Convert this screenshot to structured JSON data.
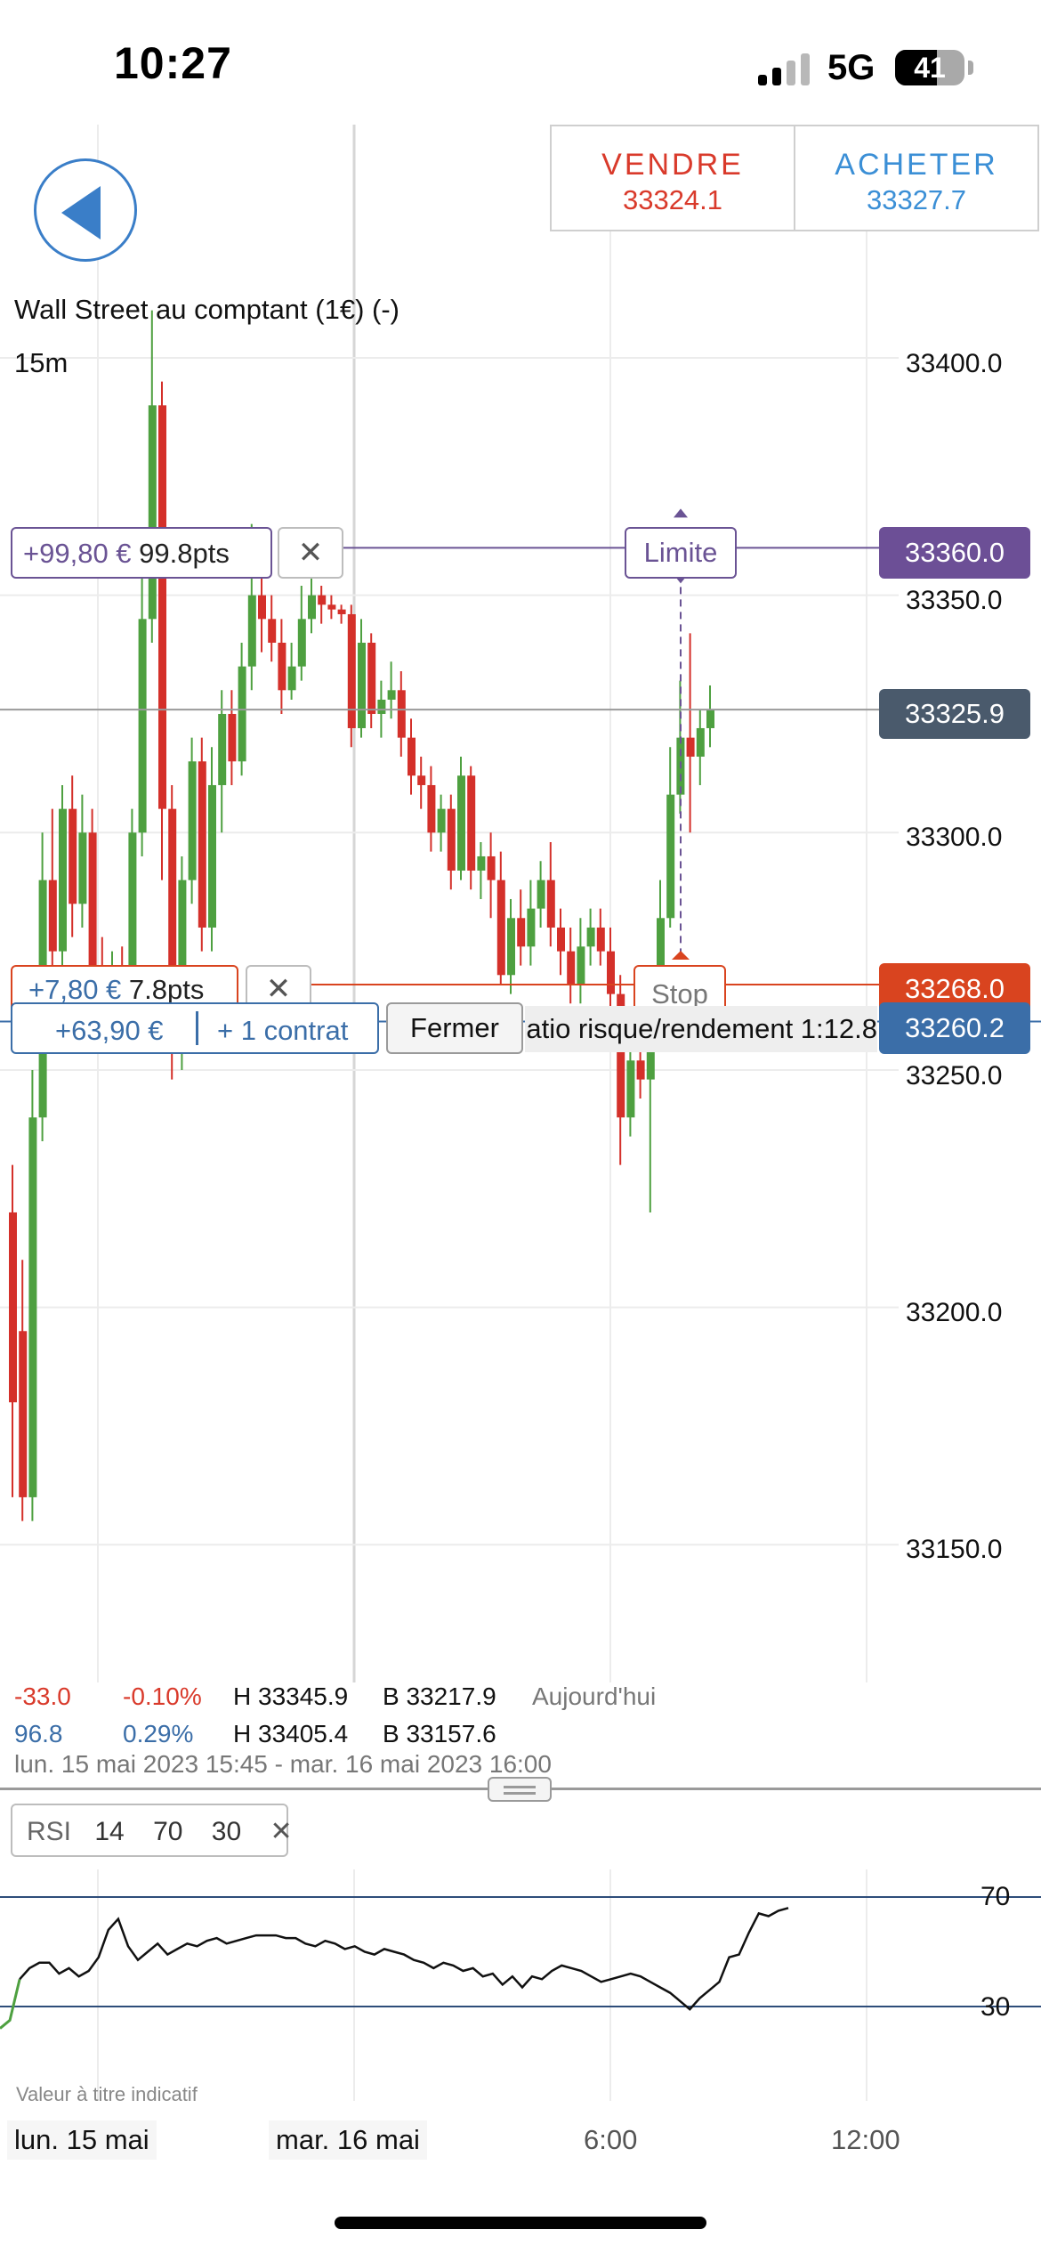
{
  "status_bar": {
    "time": "10:27",
    "network": "5G",
    "battery": "41"
  },
  "header": {
    "back_icon": "back-arrow-icon",
    "sell": {
      "label": "VENDRE",
      "price": "33324.1"
    },
    "buy": {
      "label": "ACHETER",
      "price": "33327.7"
    }
  },
  "instrument": {
    "name": "Wall Street au comptant (1€) (-)",
    "timeframe": "15m"
  },
  "price_axis": [
    "33400.0",
    "33350.0",
    "33300.0",
    "33250.0",
    "33200.0",
    "33150.0"
  ],
  "orders": {
    "limit": {
      "money": "+99,80 €",
      "points": "99.8pts",
      "button": "Limite",
      "price": "33360.0"
    },
    "current_price": "33325.9",
    "stop": {
      "money": "+7,80 €",
      "points": "7.8pts",
      "button": "Stop",
      "price": "33268.0"
    },
    "position": {
      "pl": "+63,90 €",
      "contracts": "+ 1 contrat",
      "close": "Fermer",
      "ratio": "Ratio risque/rendement 1:12.8",
      "price": "33260.2"
    }
  },
  "stats": {
    "today": {
      "change": "-33.0",
      "change_pct": "-0.10%",
      "high": "H 33345.9",
      "low": "B 33217.9",
      "label": "Aujourd'hui"
    },
    "period": {
      "change": "96.8",
      "change_pct": "0.29%",
      "high": "H 33405.4",
      "low": "B 33157.6"
    },
    "range": "lun. 15 mai 2023 15:45 - mar. 16 mai 2023 16:00"
  },
  "rsi": {
    "name": "RSI",
    "period": "14",
    "upper": "70",
    "lower": "30",
    "level_upper": "70",
    "level_lower": "30"
  },
  "footer": {
    "disclaimer": "Valeur à titre indicatif",
    "time_axis": [
      "lun. 15 mai",
      "mar. 16 mai",
      "6:00",
      "12:00"
    ]
  },
  "chart_data": {
    "type": "candlestick",
    "ylim": [
      33120,
      33420
    ],
    "up_color": "#4ea040",
    "down_color": "#d4302a",
    "candles": [
      [
        33220,
        33180,
        33230,
        33160
      ],
      [
        33195,
        33160,
        33210,
        33155
      ],
      [
        33160,
        33240,
        33250,
        33155
      ],
      [
        33240,
        33290,
        33300,
        33235
      ],
      [
        33290,
        33275,
        33305,
        33270
      ],
      [
        33275,
        33305,
        33310,
        33270
      ],
      [
        33305,
        33285,
        33312,
        33278
      ],
      [
        33285,
        33300,
        33308,
        33280
      ],
      [
        33300,
        33270,
        33305,
        33265
      ],
      [
        33270,
        33260,
        33278,
        33255
      ],
      [
        33260,
        33270,
        33275,
        33258
      ],
      [
        33270,
        33262,
        33276,
        33258
      ],
      [
        33262,
        33300,
        33305,
        33258
      ],
      [
        33300,
        33345,
        33355,
        33295
      ],
      [
        33345,
        33390,
        33410,
        33340
      ],
      [
        33390,
        33305,
        33395,
        33290
      ],
      [
        33305,
        33270,
        33310,
        33248
      ],
      [
        33270,
        33290,
        33295,
        33250
      ],
      [
        33290,
        33315,
        33320,
        33285
      ],
      [
        33315,
        33280,
        33320,
        33275
      ],
      [
        33280,
        33310,
        33318,
        33275
      ],
      [
        33310,
        33325,
        33330,
        33300
      ],
      [
        33325,
        33315,
        33330,
        33310
      ],
      [
        33315,
        33335,
        33340,
        33312
      ],
      [
        33335,
        33350,
        33365,
        33330
      ],
      [
        33350,
        33345,
        33360,
        33338
      ],
      [
        33345,
        33340,
        33350,
        33336
      ],
      [
        33340,
        33330,
        33345,
        33325
      ],
      [
        33330,
        33335,
        33340,
        33328
      ],
      [
        33335,
        33345,
        33352,
        33332
      ],
      [
        33345,
        33350,
        33356,
        33342
      ],
      [
        33350,
        33348,
        33352,
        33344
      ],
      [
        33348,
        33347,
        33350,
        33345
      ],
      [
        33347,
        33346,
        33348,
        33344
      ],
      [
        33346,
        33322,
        33348,
        33318
      ],
      [
        33322,
        33340,
        33345,
        33320
      ],
      [
        33340,
        33325,
        33342,
        33322
      ],
      [
        33325,
        33328,
        33332,
        33320
      ],
      [
        33328,
        33330,
        33336,
        33324
      ],
      [
        33330,
        33320,
        33334,
        33316
      ],
      [
        33320,
        33312,
        33324,
        33308
      ],
      [
        33312,
        33310,
        33316,
        33305
      ],
      [
        33310,
        33300,
        33314,
        33296
      ],
      [
        33300,
        33305,
        33308,
        33296
      ],
      [
        33305,
        33292,
        33308,
        33288
      ],
      [
        33292,
        33312,
        33316,
        33290
      ],
      [
        33312,
        33292,
        33314,
        33288
      ],
      [
        33292,
        33295,
        33298,
        33286
      ],
      [
        33295,
        33290,
        33300,
        33282
      ],
      [
        33290,
        33270,
        33296,
        33268
      ],
      [
        33270,
        33282,
        33286,
        33266
      ],
      [
        33282,
        33276,
        33288,
        33272
      ],
      [
        33276,
        33284,
        33290,
        33272
      ],
      [
        33284,
        33290,
        33294,
        33280
      ],
      [
        33290,
        33280,
        33298,
        33276
      ],
      [
        33280,
        33275,
        33284,
        33270
      ],
      [
        33275,
        33268,
        33280,
        33264
      ],
      [
        33268,
        33276,
        33282,
        33264
      ],
      [
        33276,
        33280,
        33284,
        33272
      ],
      [
        33280,
        33275,
        33284,
        33272
      ],
      [
        33275,
        33266,
        33280,
        33262
      ],
      [
        33266,
        33240,
        33270,
        33230
      ],
      [
        33240,
        33252,
        33256,
        33236
      ],
      [
        33252,
        33248,
        33262,
        33244
      ],
      [
        33248,
        33260,
        33266,
        33220
      ],
      [
        33260,
        33282,
        33290,
        33256
      ],
      [
        33282,
        33308,
        33318,
        33280
      ],
      [
        33308,
        33320,
        33332,
        33304
      ],
      [
        33320,
        33316,
        33342,
        33300
      ],
      [
        33316,
        33322,
        33326,
        33310
      ],
      [
        33322,
        33326,
        33331,
        33318
      ]
    ]
  },
  "colors": {
    "limit": "#6a5394",
    "stop": "#d9441f",
    "position": "#3b6ea8",
    "current": "#4a5a6c",
    "rsi_level_line": "#2e4d7a",
    "rsi_line": "#111111"
  },
  "rsi_series": [
    22,
    25,
    40,
    44,
    46,
    46,
    42,
    44,
    41,
    43,
    48,
    58,
    62,
    52,
    47,
    50,
    53,
    49,
    51,
    53,
    52,
    54,
    55,
    53,
    54,
    55,
    56,
    56,
    56,
    55,
    55,
    53,
    52,
    54,
    53,
    51,
    52,
    50,
    49,
    51,
    50,
    49,
    47,
    46,
    44,
    46,
    45,
    43,
    44,
    41,
    42,
    38,
    41,
    37,
    41,
    40,
    43,
    45,
    44,
    43,
    41,
    39,
    40,
    41,
    42,
    41,
    39,
    37,
    35,
    32,
    29,
    33,
    36,
    39,
    48,
    49,
    57,
    64,
    63,
    65,
    66
  ]
}
